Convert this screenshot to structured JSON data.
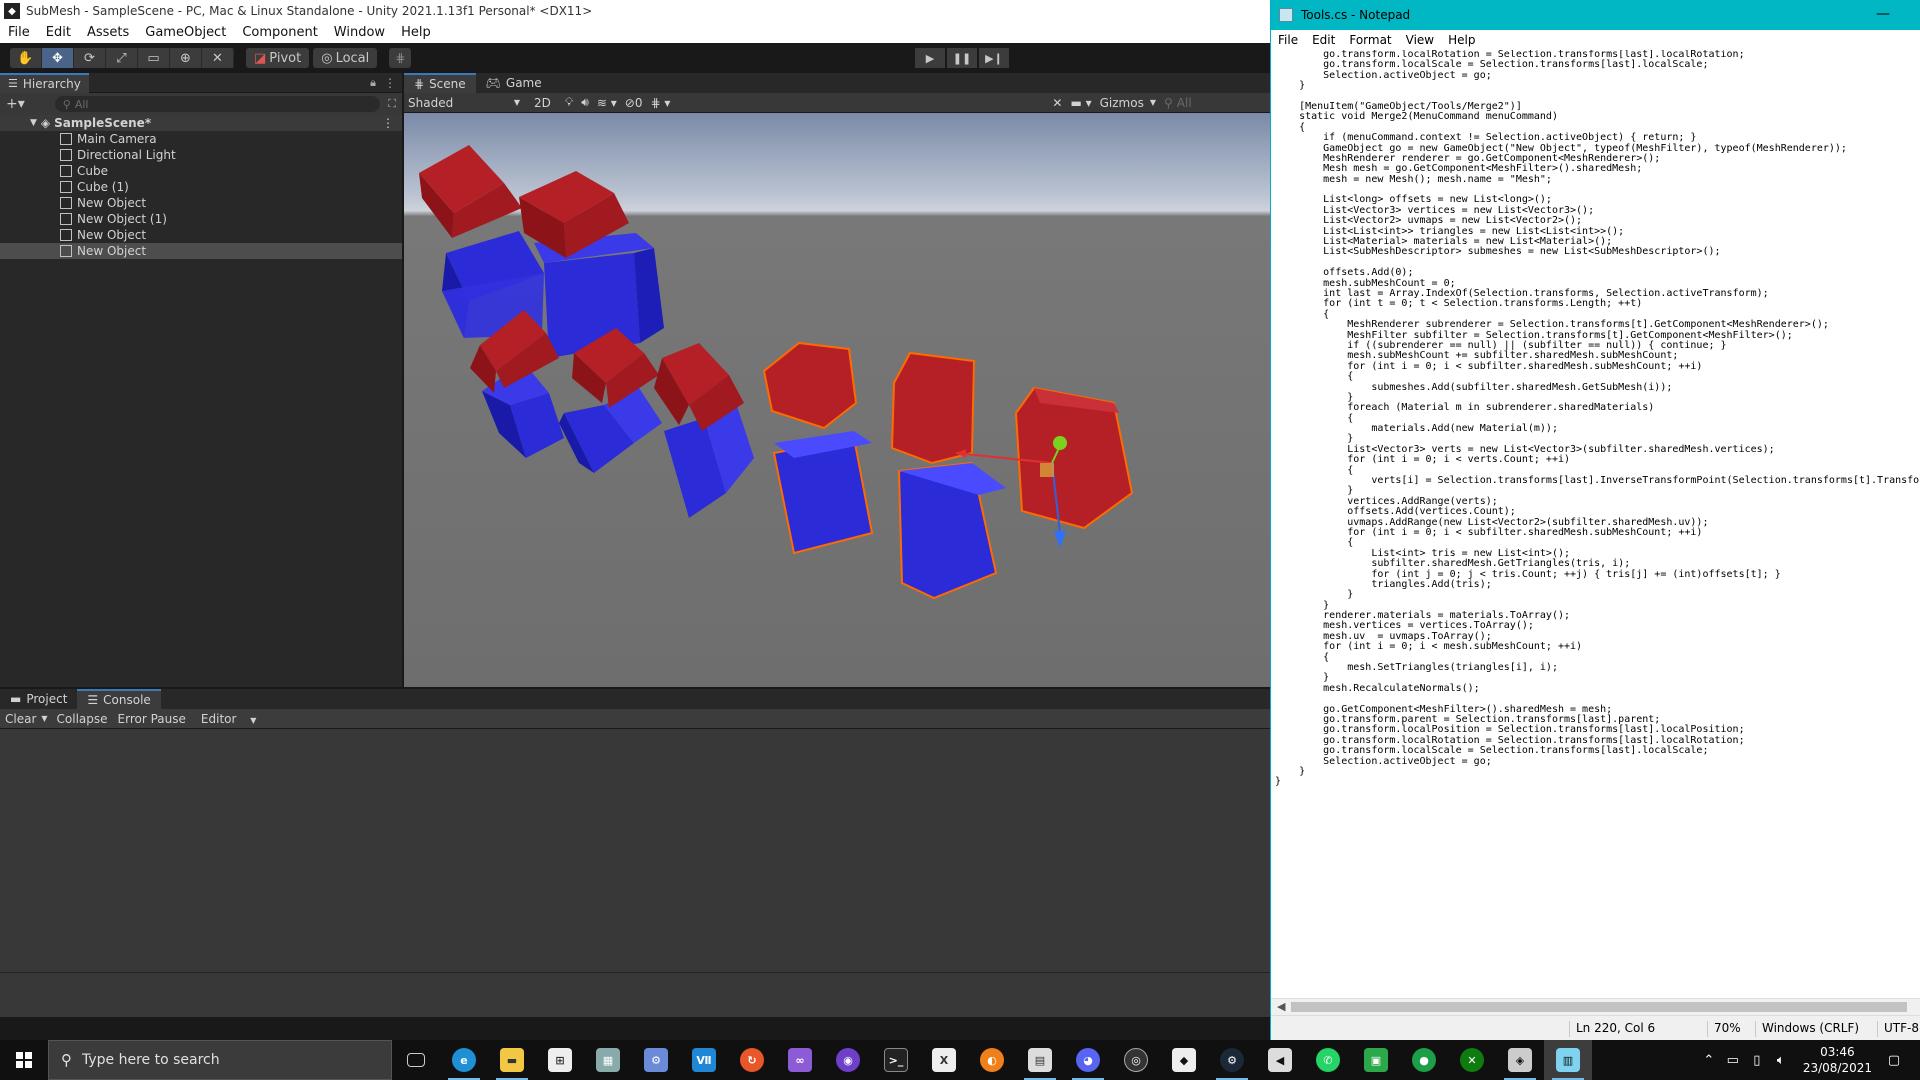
{
  "unity": {
    "title": "SubMesh - SampleScene - PC, Mac & Linux Standalone - Unity 2021.1.13f1 Personal* <DX11>",
    "menu": [
      "File",
      "Edit",
      "Assets",
      "GameObject",
      "Component",
      "Window",
      "Help"
    ],
    "toolbar": {
      "pivot_label": "Pivot",
      "local_label": "Local"
    },
    "hierarchy": {
      "tab_label": "Hierarchy",
      "search_placeholder": "All",
      "scene_name": "SampleScene*",
      "items": [
        "Main Camera",
        "Directional Light",
        "Cube",
        "Cube (1)",
        "New Object",
        "New Object (1)",
        "New Object",
        "New Object"
      ],
      "selected_index": 7
    },
    "scene": {
      "tabs": [
        "Scene",
        "Game"
      ],
      "shading_mode": "Shaded",
      "mode_2d": "2D",
      "hidden_count": "0",
      "gizmos_label": "Gizmos",
      "search_placeholder": "All"
    },
    "bottom": {
      "tabs": [
        "Project",
        "Console"
      ],
      "console_buttons": [
        "Clear",
        "Collapse",
        "Error Pause",
        "Editor"
      ]
    }
  },
  "notepad": {
    "title": "Tools.cs - Notepad",
    "menu": [
      "File",
      "Edit",
      "Format",
      "View",
      "Help"
    ],
    "code_lines": [
      "        go.transform.localRotation = Selection.transforms[last].localRotation;",
      "        go.transform.localScale = Selection.transforms[last].localScale;",
      "        Selection.activeObject = go;",
      "    }",
      "",
      "    [MenuItem(\"GameObject/Tools/Merge2\")]",
      "    static void Merge2(MenuCommand menuCommand)",
      "    {",
      "        if (menuCommand.context != Selection.activeObject) { return; }",
      "        GameObject go = new GameObject(\"New Object\", typeof(MeshFilter), typeof(MeshRenderer));",
      "        MeshRenderer renderer = go.GetComponent<MeshRenderer>();",
      "        Mesh mesh = go.GetComponent<MeshFilter>().sharedMesh;",
      "        mesh = new Mesh(); mesh.name = \"Mesh\";",
      "",
      "        List<long> offsets = new List<long>();",
      "        List<Vector3> vertices = new List<Vector3>();",
      "        List<Vector2> uvmaps = new List<Vector2>();",
      "        List<List<int>> triangles = new List<List<int>>();",
      "        List<Material> materials = new List<Material>();",
      "        List<SubMeshDescriptor> submeshes = new List<SubMeshDescriptor>();",
      "",
      "        offsets.Add(0);",
      "        mesh.subMeshCount = 0;",
      "        int last = Array.IndexOf(Selection.transforms, Selection.activeTransform);",
      "        for (int t = 0; t < Selection.transforms.Length; ++t)",
      "        {",
      "            MeshRenderer subrenderer = Selection.transforms[t].GetComponent<MeshRenderer>();",
      "            MeshFilter subfilter = Selection.transforms[t].GetComponent<MeshFilter>();",
      "            if ((subrenderer == null) || (subfilter == null)) { continue; }",
      "            mesh.subMeshCount += subfilter.sharedMesh.subMeshCount;",
      "            for (int i = 0; i < subfilter.sharedMesh.subMeshCount; ++i)",
      "            {",
      "                submeshes.Add(subfilter.sharedMesh.GetSubMesh(i));",
      "            }",
      "            foreach (Material m in subrenderer.sharedMaterials)",
      "            {",
      "                materials.Add(new Material(m));",
      "            }",
      "            List<Vector3> verts = new List<Vector3>(subfilter.sharedMesh.vertices);",
      "            for (int i = 0; i < verts.Count; ++i)",
      "            {",
      "                verts[i] = Selection.transforms[last].InverseTransformPoint(Selection.transforms[t].Transfor",
      "            }",
      "            vertices.AddRange(verts);",
      "            offsets.Add(vertices.Count);",
      "            uvmaps.AddRange(new List<Vector2>(subfilter.sharedMesh.uv));",
      "            for (int i = 0; i < subfilter.sharedMesh.subMeshCount; ++i)",
      "            {",
      "                List<int> tris = new List<int>();",
      "                subfilter.sharedMesh.GetTriangles(tris, i);",
      "                for (int j = 0; j < tris.Count; ++j) { tris[j] += (int)offsets[t]; }",
      "                triangles.Add(tris);",
      "            }",
      "        }",
      "        renderer.materials = materials.ToArray();",
      "        mesh.vertices = vertices.ToArray();",
      "        mesh.uv  = uvmaps.ToArray();",
      "        for (int i = 0; i < mesh.subMeshCount; ++i)",
      "        {",
      "            mesh.SetTriangles(triangles[i], i);",
      "        }",
      "        mesh.RecalculateNormals();",
      "",
      "        go.GetComponent<MeshFilter>().sharedMesh = mesh;",
      "        go.transform.parent = Selection.transforms[last].parent;",
      "        go.transform.localPosition = Selection.transforms[last].localPosition;",
      "        go.transform.localRotation = Selection.transforms[last].localRotation;",
      "        go.transform.localScale = Selection.transforms[last].localScale;",
      "        Selection.activeObject = go;",
      "    }",
      "}"
    ],
    "status": {
      "position": "Ln 220, Col 6",
      "zoom": "70%",
      "line_ending": "Windows (CRLF)",
      "encoding": "UTF-8"
    }
  },
  "taskbar": {
    "search_placeholder": "Type here to search",
    "time": "03:46",
    "date": "23/08/2021",
    "apps": [
      "task-view",
      "edge",
      "file-explorer",
      "store",
      "app-5",
      "app-6",
      "vscode",
      "app-8",
      "visual-studio",
      "github",
      "terminal",
      "excel",
      "blender",
      "notepad-file",
      "discord",
      "obs",
      "unity-hub",
      "steam",
      "unity",
      "whatsapp",
      "app-21",
      "app-22",
      "xbox",
      "unity-editor",
      "notepad"
    ],
    "colors": {
      "edge": "#1f8fd6",
      "explorer": "#f2c744",
      "vscode": "#1f87d6",
      "visual_studio": "#8c5bd6",
      "discord": "#5865f2",
      "whatsapp": "#25d366",
      "xbox": "#107c10"
    }
  },
  "scene_colors": {
    "red_cube": "#b52027",
    "blue_cube": "#2b2bd8",
    "selection_outline": "#ff6a00",
    "skybox_top": "#7a8aa8",
    "ground": "#6e6e6e"
  }
}
